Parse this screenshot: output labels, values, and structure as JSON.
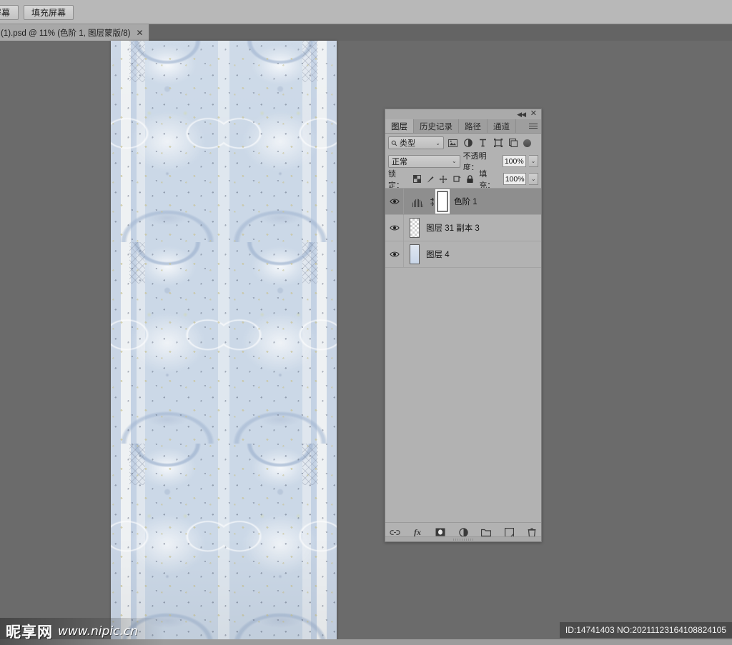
{
  "options_bar": {
    "buttons": [
      {
        "label": "屏幕",
        "name": "fit-screen-button"
      },
      {
        "label": "填充屏幕",
        "name": "fill-screen-button"
      }
    ]
  },
  "document_tab": {
    "title": "(1).psd @ 11% (色阶 1, 图层蒙版/8)",
    "close": "✕"
  },
  "layers_panel": {
    "titlebar": {
      "collapse": "◀◀",
      "close": "✕"
    },
    "tabs": [
      {
        "label": "图层",
        "active": true
      },
      {
        "label": "历史记录",
        "active": false
      },
      {
        "label": "路径",
        "active": false
      },
      {
        "label": "通道",
        "active": false
      }
    ],
    "menu_icon": "panel-menu-icon",
    "filter": {
      "search_icon": "🔍",
      "value": "类型",
      "caret": "⌄",
      "icons": [
        "image-filter-icon",
        "adjustment-filter-icon",
        "text-filter-icon",
        "shape-filter-icon",
        "smart-object-filter-icon"
      ],
      "toggle": "filter-toggle"
    },
    "blend": {
      "mode": "正常",
      "caret": "⌄",
      "opacity_label": "不透明度：",
      "opacity_value": "100%"
    },
    "lock": {
      "label": "锁定：",
      "icons": [
        "lock-transparent-icon",
        "lock-image-icon",
        "lock-position-icon",
        "lock-artboard-icon",
        "lock-all-icon"
      ],
      "fill_label": "填充：",
      "fill_value": "100%"
    },
    "layers": [
      {
        "name": "色阶 1",
        "name_main": "色阶",
        "name_num": "1",
        "visible": true,
        "selected": true,
        "type": "adjustment",
        "has_link": true,
        "has_mask": true
      },
      {
        "name": "图层 31 副本 3",
        "name_main": "图层",
        "name_num": "31 副本 3",
        "visible": true,
        "selected": false,
        "type": "pixel-checker",
        "has_link": false,
        "has_mask": false
      },
      {
        "name": "图层 4",
        "name_main": "图层",
        "name_num": "4",
        "visible": true,
        "selected": false,
        "type": "pixel-flat",
        "has_link": false,
        "has_mask": false
      }
    ],
    "footer_icons": [
      {
        "name": "link-layers-icon",
        "glyph": "⚭"
      },
      {
        "name": "layer-style-fx-icon",
        "glyph": "fx"
      },
      {
        "name": "add-layer-mask-icon",
        "glyph": "▣"
      },
      {
        "name": "new-fill-adjustment-icon",
        "glyph": "◐"
      },
      {
        "name": "new-group-icon",
        "glyph": "▭"
      },
      {
        "name": "new-layer-icon",
        "glyph": "⧉"
      },
      {
        "name": "delete-layer-icon",
        "glyph": "🗑"
      }
    ]
  },
  "watermark": {
    "logo": "昵享网",
    "url": "www.nipic.cn"
  },
  "id_badge": {
    "text": "ID:14741403 NO:20211123164108824105"
  },
  "colors": {
    "workspace": "#6b6b6b",
    "panel_bg": "#b2b2b2",
    "panel_tab_bg": "#9e9e9e",
    "selected_row": "#8e8e8e",
    "options_bar": "#b8b8b8",
    "artwork_blue": "#c9d5e5",
    "artwork_cream": "#eef1f3"
  }
}
